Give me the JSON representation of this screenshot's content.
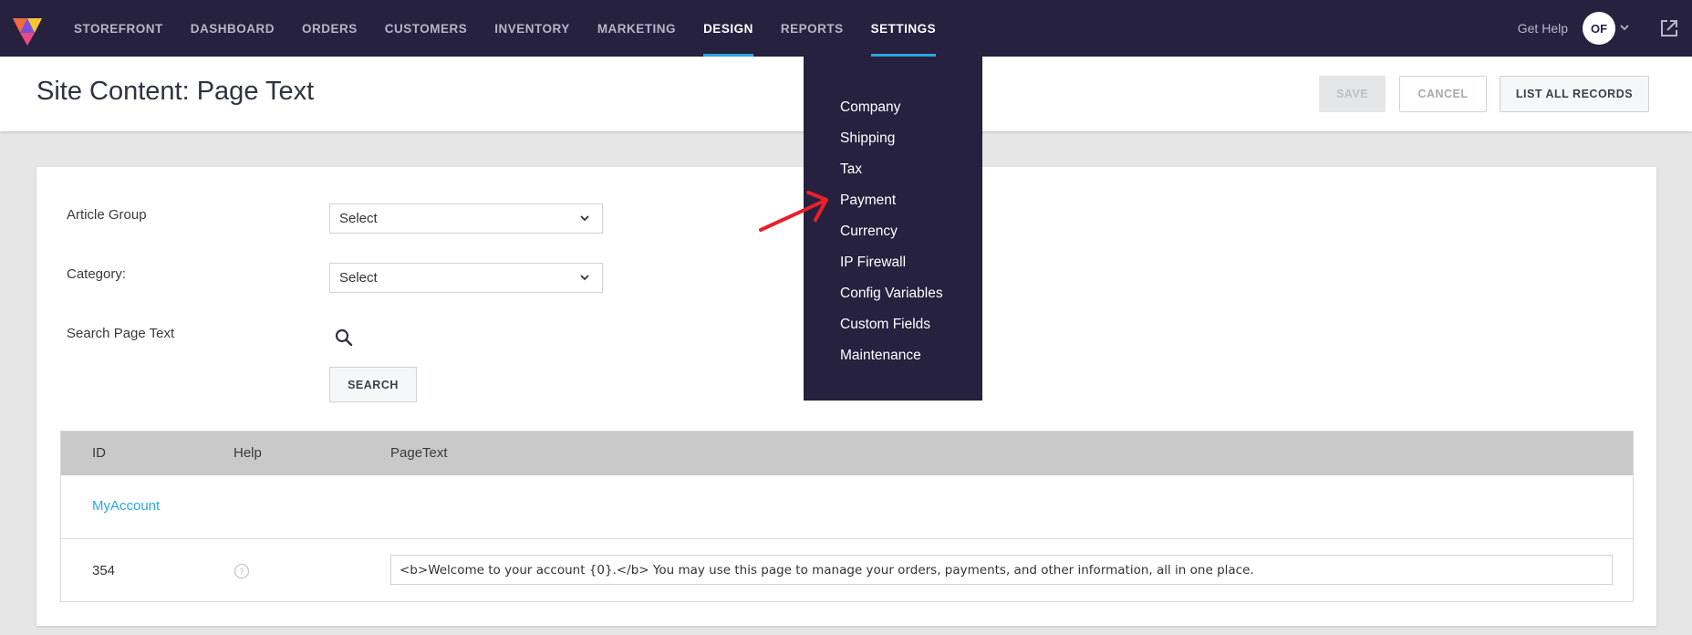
{
  "nav": {
    "items": [
      {
        "label": "STOREFRONT"
      },
      {
        "label": "DASHBOARD"
      },
      {
        "label": "ORDERS"
      },
      {
        "label": "CUSTOMERS"
      },
      {
        "label": "INVENTORY"
      },
      {
        "label": "MARKETING"
      },
      {
        "label": "DESIGN",
        "active": true
      },
      {
        "label": "REPORTS"
      },
      {
        "label": "SETTINGS",
        "active": true
      }
    ],
    "get_help": "Get Help",
    "avatar_initials": "OF",
    "icons": [
      "logo-icon",
      "chevron-down-icon",
      "external-link-icon"
    ]
  },
  "header": {
    "title": "Site Content: Page Text",
    "save_label": "SAVE",
    "cancel_label": "CANCEL",
    "list_all_label": "LIST ALL RECORDS"
  },
  "filters": {
    "article_group_label": "Article Group",
    "article_group_value": "Select",
    "category_label": "Category:",
    "category_value": "Select",
    "search_label": "Search Page Text",
    "search_button": "SEARCH"
  },
  "table": {
    "columns": [
      "ID",
      "Help",
      "PageText"
    ],
    "group": "MyAccount",
    "rows": [
      {
        "id": "354",
        "pagetext": "<b>Welcome to your account {0}.</b> You may use this page to manage your orders, payments, and other information, all in one place."
      }
    ]
  },
  "settings_menu": {
    "items": [
      "Company",
      "Shipping",
      "Tax",
      "Payment",
      "Currency",
      "IP Firewall",
      "Config Variables",
      "Custom Fields",
      "Maintenance"
    ]
  },
  "colors": {
    "nav_bg": "#26213f",
    "accent": "#2ba8e0",
    "annotation_arrow": "#e8202a"
  }
}
